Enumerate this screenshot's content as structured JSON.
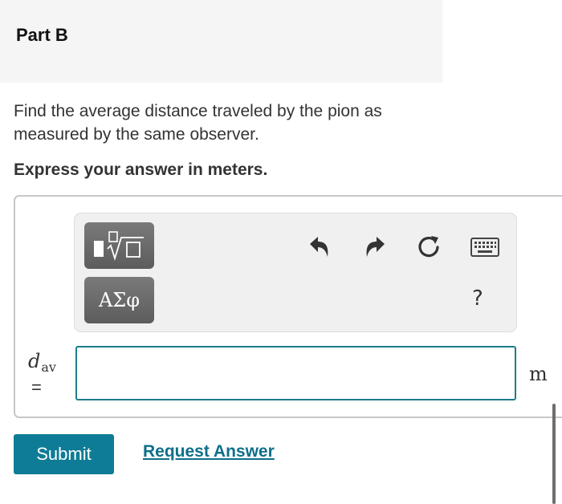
{
  "part": {
    "title": "Part B"
  },
  "question": {
    "text": "Find the average distance traveled by the pion as measured by the same observer.",
    "instruction": "Express your answer in meters."
  },
  "toolbar": {
    "greek_label": "ΑΣφ",
    "help_label": "?",
    "icons": [
      "templates-icon",
      "undo-icon",
      "redo-icon",
      "reset-icon",
      "keyboard-icon",
      "help-icon"
    ]
  },
  "answer": {
    "variable": "d",
    "subscript": "av",
    "equals": "=",
    "value": "",
    "unit": "m"
  },
  "actions": {
    "submit_label": "Submit",
    "request_label": "Request Answer"
  },
  "colors": {
    "accent": "#0e7c96",
    "link": "#0e6f8a",
    "input_border": "#1f7b8b",
    "button_gray": "#6b6b6b"
  }
}
